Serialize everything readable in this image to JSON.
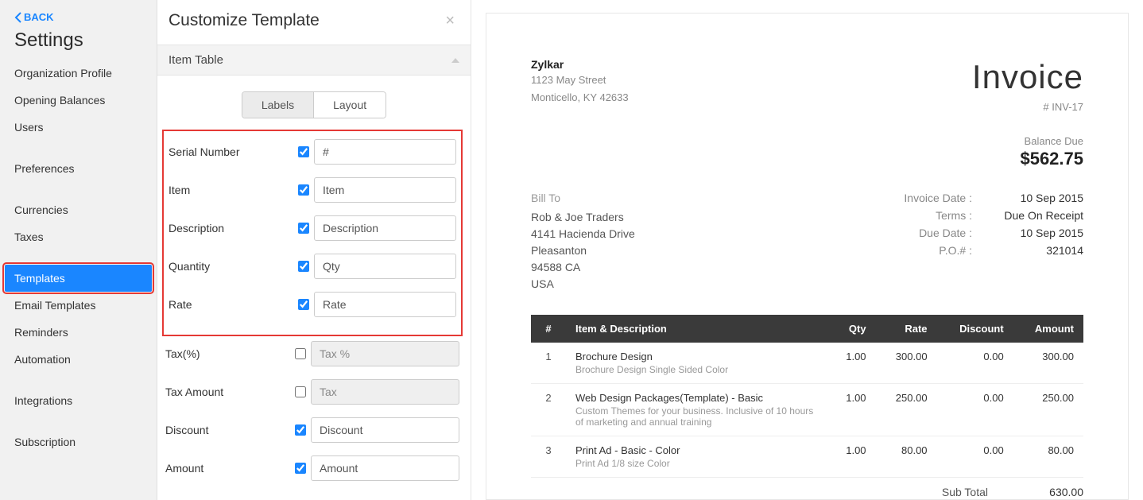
{
  "sidebar": {
    "back_label": "BACK",
    "title": "Settings",
    "items": [
      {
        "label": "Organization Profile",
        "active": false,
        "space_above": false
      },
      {
        "label": "Opening Balances",
        "active": false,
        "space_above": false
      },
      {
        "label": "Users",
        "active": false,
        "space_above": false
      },
      {
        "label": "Preferences",
        "active": false,
        "space_above": true
      },
      {
        "label": "Currencies",
        "active": false,
        "space_above": true
      },
      {
        "label": "Taxes",
        "active": false,
        "space_above": false
      },
      {
        "label": "Templates",
        "active": true,
        "space_above": true
      },
      {
        "label": "Email Templates",
        "active": false,
        "space_above": false
      },
      {
        "label": "Reminders",
        "active": false,
        "space_above": false
      },
      {
        "label": "Automation",
        "active": false,
        "space_above": false
      },
      {
        "label": "Integrations",
        "active": false,
        "space_above": true
      },
      {
        "label": "Subscription",
        "active": false,
        "space_above": true
      }
    ]
  },
  "center": {
    "title": "Customize Template",
    "section_title": "Item Table",
    "tabs": {
      "labels": "Labels",
      "layout": "Layout",
      "active": "labels"
    },
    "highlight_count": 5,
    "fields": [
      {
        "label": "Serial Number",
        "checked": true,
        "value": "#"
      },
      {
        "label": "Item",
        "checked": true,
        "value": "Item"
      },
      {
        "label": "Description",
        "checked": true,
        "value": "Description"
      },
      {
        "label": "Quantity",
        "checked": true,
        "value": "Qty"
      },
      {
        "label": "Rate",
        "checked": true,
        "value": "Rate"
      },
      {
        "label": "Tax(%)",
        "checked": false,
        "value": "Tax %"
      },
      {
        "label": "Tax Amount",
        "checked": false,
        "value": "Tax"
      },
      {
        "label": "Discount",
        "checked": true,
        "value": "Discount"
      },
      {
        "label": "Amount",
        "checked": true,
        "value": "Amount"
      }
    ]
  },
  "preview": {
    "company": {
      "name": "Zylkar",
      "addr1": "1123 May Street",
      "addr2": "Monticello, KY 42633"
    },
    "invoice_title": "Invoice",
    "invoice_number": "# INV-17",
    "balance_label": "Balance Due",
    "balance_amount": "$562.75",
    "billto_label": "Bill To",
    "billto_lines": [
      "Rob & Joe Traders",
      "4141 Hacienda Drive",
      "Pleasanton",
      "94588 CA",
      "USA"
    ],
    "meta": [
      {
        "k": "Invoice Date :",
        "v": "10 Sep 2015"
      },
      {
        "k": "Terms :",
        "v": "Due On Receipt"
      },
      {
        "k": "Due Date :",
        "v": "10 Sep 2015"
      },
      {
        "k": "P.O.# :",
        "v": "321014"
      }
    ],
    "table": {
      "headers": {
        "idx": "#",
        "desc": "Item & Description",
        "qty": "Qty",
        "rate": "Rate",
        "discount": "Discount",
        "amount": "Amount"
      },
      "rows": [
        {
          "idx": "1",
          "title": "Brochure Design",
          "sub": "Brochure Design Single Sided Color",
          "qty": "1.00",
          "rate": "300.00",
          "discount": "0.00",
          "amount": "300.00"
        },
        {
          "idx": "2",
          "title": "Web Design Packages(Template) - Basic",
          "sub": "Custom Themes for your business. Inclusive of 10 hours of marketing and annual training",
          "qty": "1.00",
          "rate": "250.00",
          "discount": "0.00",
          "amount": "250.00"
        },
        {
          "idx": "3",
          "title": "Print Ad - Basic - Color",
          "sub": "Print Ad 1/8 size Color",
          "qty": "1.00",
          "rate": "80.00",
          "discount": "0.00",
          "amount": "80.00"
        }
      ]
    },
    "subtotal_label": "Sub Total",
    "subtotal_value": "630.00"
  }
}
